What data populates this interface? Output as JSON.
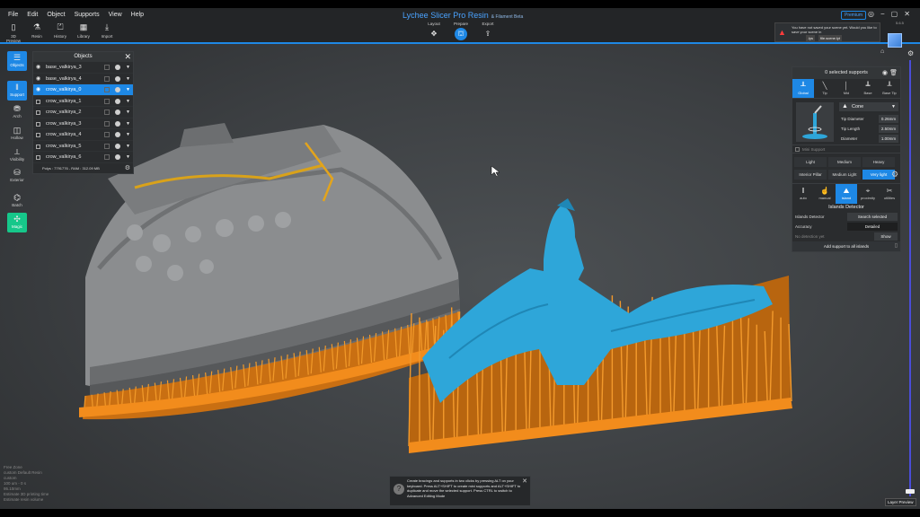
{
  "menu": [
    "File",
    "Edit",
    "Object",
    "Supports",
    "View",
    "Help"
  ],
  "title": "Lychee Slicer Pro Resin",
  "title_suffix": "& Filament Beta",
  "toolbar": [
    {
      "label": "3D Preview",
      "icon": "phone-icon"
    },
    {
      "label": "Resin",
      "icon": "resin-icon"
    },
    {
      "label": "History",
      "icon": "history-icon"
    },
    {
      "label": "Library",
      "icon": "library-icon"
    },
    {
      "label": "Import",
      "icon": "import-icon"
    }
  ],
  "modes": [
    {
      "label": "Layout",
      "icon": "layout-icon",
      "active": false
    },
    {
      "label": "Prepare",
      "icon": "prepare-icon",
      "active": true
    },
    {
      "label": "Export",
      "icon": "export-icon",
      "active": false
    }
  ],
  "premium": "Premium",
  "version": "5.6.5",
  "notification": {
    "message": "You have not saved your scene yet. Would you like to save your scene in",
    "buttons": [
      ".lys",
      "file.scene.lyt"
    ]
  },
  "left_tools": [
    {
      "label": "Objects",
      "icon": "objects-icon",
      "state": "sel"
    },
    {
      "label": "Support",
      "icon": "support-icon",
      "state": "sel"
    },
    {
      "label": "Arch",
      "icon": "arch-icon",
      "state": ""
    },
    {
      "label": "Hollow",
      "icon": "hollow-icon",
      "state": ""
    },
    {
      "label": "Visibility",
      "icon": "visibility-icon",
      "state": ""
    },
    {
      "label": "Exterior",
      "icon": "exterior-icon",
      "state": ""
    },
    {
      "label": "Batch",
      "icon": "batch-icon",
      "state": ""
    },
    {
      "label": "Magic",
      "icon": "magic-icon",
      "state": "green"
    }
  ],
  "objects_panel": {
    "title": "Objects",
    "items": [
      {
        "name": "base_valkirya_3",
        "visible": true,
        "selected": false
      },
      {
        "name": "base_valkirya_4",
        "visible": true,
        "selected": false
      },
      {
        "name": "crow_valkirya_0",
        "visible": true,
        "selected": true
      },
      {
        "name": "crow_valkirya_1",
        "visible": false,
        "selected": false
      },
      {
        "name": "crow_valkirya_2",
        "visible": false,
        "selected": false
      },
      {
        "name": "crow_valkirya_3",
        "visible": false,
        "selected": false
      },
      {
        "name": "crow_valkirya_4",
        "visible": false,
        "selected": false
      },
      {
        "name": "crow_valkirya_5",
        "visible": false,
        "selected": false
      },
      {
        "name": "crow_valkirya_6",
        "visible": false,
        "selected": false
      }
    ],
    "polys": "Polys : 7791776 - RAM : 312.09 MB"
  },
  "support_panel": {
    "selected": "0 selected supports",
    "tip_tabs": [
      {
        "label": "Global",
        "icon": "global-icon",
        "selected": true
      },
      {
        "label": "Tip",
        "icon": "tip-icon",
        "selected": false
      },
      {
        "label": "Mid",
        "icon": "mid-icon",
        "selected": false
      },
      {
        "label": "Base",
        "icon": "base-icon",
        "selected": false
      },
      {
        "label": "Base Tip",
        "icon": "base-tip-icon",
        "selected": false
      }
    ],
    "shape": "Cone",
    "params": [
      {
        "label": "Tip Diameter",
        "value": "0.26mm"
      },
      {
        "label": "Tip Length",
        "value": "2.50mm"
      },
      {
        "label": "Diameter",
        "value": "1.00mm"
      }
    ],
    "mini_support": "Mini Support",
    "densities": [
      {
        "label": "Light",
        "selected": false
      },
      {
        "label": "Medium",
        "selected": false
      },
      {
        "label": "Heavy",
        "selected": false
      },
      {
        "label": "Interior Pillar",
        "selected": false
      },
      {
        "label": "Medium Light",
        "selected": false
      },
      {
        "label": "Very light",
        "selected": true
      }
    ],
    "mode_tabs": [
      {
        "label": "auto",
        "icon": "auto-icon",
        "selected": false
      },
      {
        "label": "manual",
        "icon": "manual-icon",
        "selected": false
      },
      {
        "label": "island",
        "icon": "island-icon",
        "selected": true
      },
      {
        "label": "proximity",
        "icon": "proximity-icon",
        "selected": false
      },
      {
        "label": "utilities",
        "icon": "utilities-icon",
        "selected": false
      }
    ],
    "section": "Islands Detector",
    "detector_label": "Islands Detector",
    "search_btn": "Search selected",
    "accuracy_label": "Accuracy",
    "accuracy_value": "Detailed",
    "no_detection": "No detection yet",
    "show_btn": "Show",
    "add_all": "Add support to all islands"
  },
  "layer_preview": "Layer Preview",
  "tooltip": "Create bracings and supports in two clicks by pressing ALT on your keyboard. Press ALT+SHIFT to create mini supports and ALT+SHIFT to duplicate and move the selected support. Press CTRL to switch to Advanced Editing Mode",
  "status_lines": [
    "Free Zone",
    "custom Default Resin",
    "custom",
    "100 um - 0 s",
    "95.10mm",
    "Estimate 3D printing time",
    "Estimate resin volume"
  ],
  "colors": {
    "accent": "#1e88e5",
    "support": "#f28c1c",
    "model_blue": "#2ea6d9",
    "model_grey": "#8d8f90"
  }
}
